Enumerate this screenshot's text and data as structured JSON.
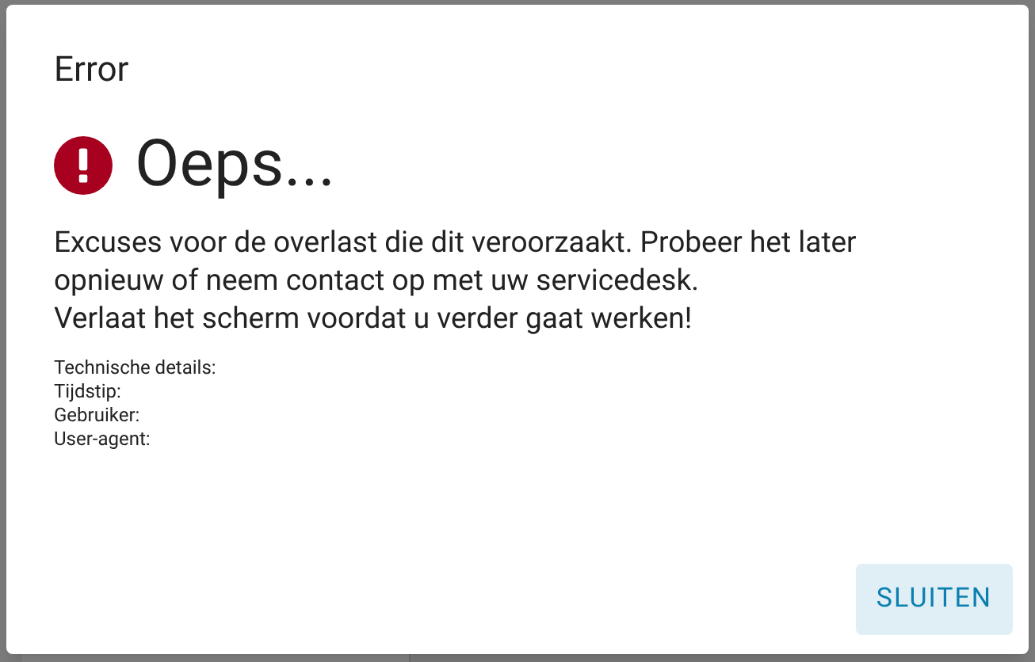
{
  "dialog": {
    "title": "Error",
    "heading": "Oeps...",
    "message_lines": [
      "Excuses voor de overlast die dit veroorzaakt. Probeer het later opnieuw of neem contact op met uw servicedesk.",
      "Verlaat het scherm voordat u verder gaat werken!"
    ],
    "details": [
      "Technische details:",
      "Tijdstip:",
      "Gebruiker:",
      "User-agent:"
    ],
    "button": "SLUITEN"
  }
}
